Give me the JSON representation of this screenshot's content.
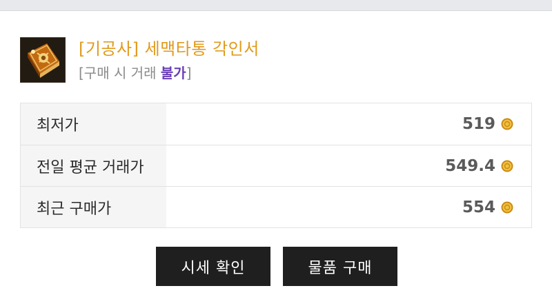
{
  "item": {
    "name": "[기공사] 세맥타통 각인서",
    "trade_note_prefix": "[구매 시 거래 ",
    "trade_note_status": "불가",
    "trade_note_suffix": "]",
    "icon": "engraving-book-icon",
    "name_color": "#e09a1b",
    "status_color": "#6a3fb6"
  },
  "prices": [
    {
      "label": "최저가",
      "value": "519",
      "currency_icon": "gold-coin-icon"
    },
    {
      "label": "전일 평균 거래가",
      "value": "549.4",
      "currency_icon": "gold-coin-icon"
    },
    {
      "label": "최근 구매가",
      "value": "554",
      "currency_icon": "gold-coin-icon"
    }
  ],
  "buttons": {
    "market_check": "시세 확인",
    "purchase": "물품 구매"
  }
}
